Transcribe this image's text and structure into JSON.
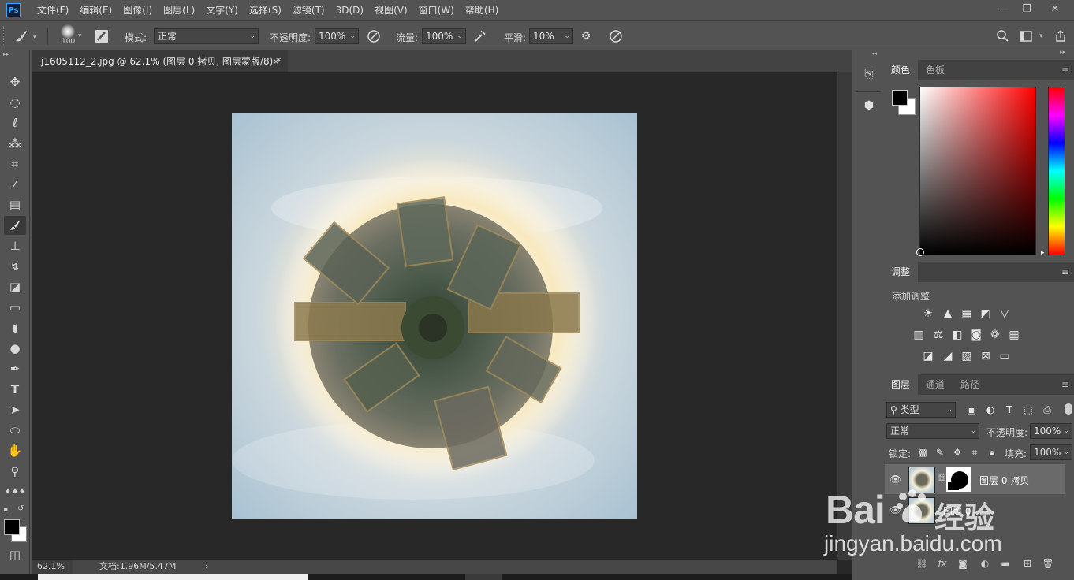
{
  "app": {
    "logo": "Ps"
  },
  "menu": [
    "文件(F)",
    "编辑(E)",
    "图像(I)",
    "图层(L)",
    "文字(Y)",
    "选择(S)",
    "滤镜(T)",
    "3D(D)",
    "视图(V)",
    "窗口(W)",
    "帮助(H)"
  ],
  "window_controls": {
    "minimize": "—",
    "restore": "❐",
    "close": "✕"
  },
  "options": {
    "brush_size": "100",
    "mode_label": "模式:",
    "mode_value": "正常",
    "opacity_label": "不透明度:",
    "opacity_value": "100%",
    "flow_label": "流量:",
    "flow_value": "100%",
    "smooth_label": "平滑:",
    "smooth_value": "10%"
  },
  "document": {
    "tab_title": "j1605112_2.jpg @ 62.1% (图层 0 拷贝, 图层蒙版/8) *",
    "tab_close": "×",
    "zoom": "62.1%",
    "doc_info": "文档:1.96M/5.47M"
  },
  "panels": {
    "color": {
      "tabs": [
        "颜色",
        "色板"
      ],
      "foreground": "#000000",
      "background": "#ffffff"
    },
    "adjustments": {
      "tab": "调整",
      "add_label": "添加调整"
    },
    "layers": {
      "tabs": [
        "图层",
        "通道",
        "路径"
      ],
      "filter_kind": "类型",
      "blend_mode": "正常",
      "opacity_label": "不透明度:",
      "opacity_value": "100%",
      "lock_label": "锁定:",
      "fill_label": "填充:",
      "fill_value": "100%",
      "items": [
        {
          "name": "图层 0 拷贝",
          "has_mask": true,
          "selected": true
        },
        {
          "name": "图层 0",
          "has_mask": false,
          "selected": false
        }
      ]
    }
  },
  "watermark": {
    "brand": "Bai",
    "brand_suffix": "经验",
    "url": "jingyan.baidu.com"
  }
}
